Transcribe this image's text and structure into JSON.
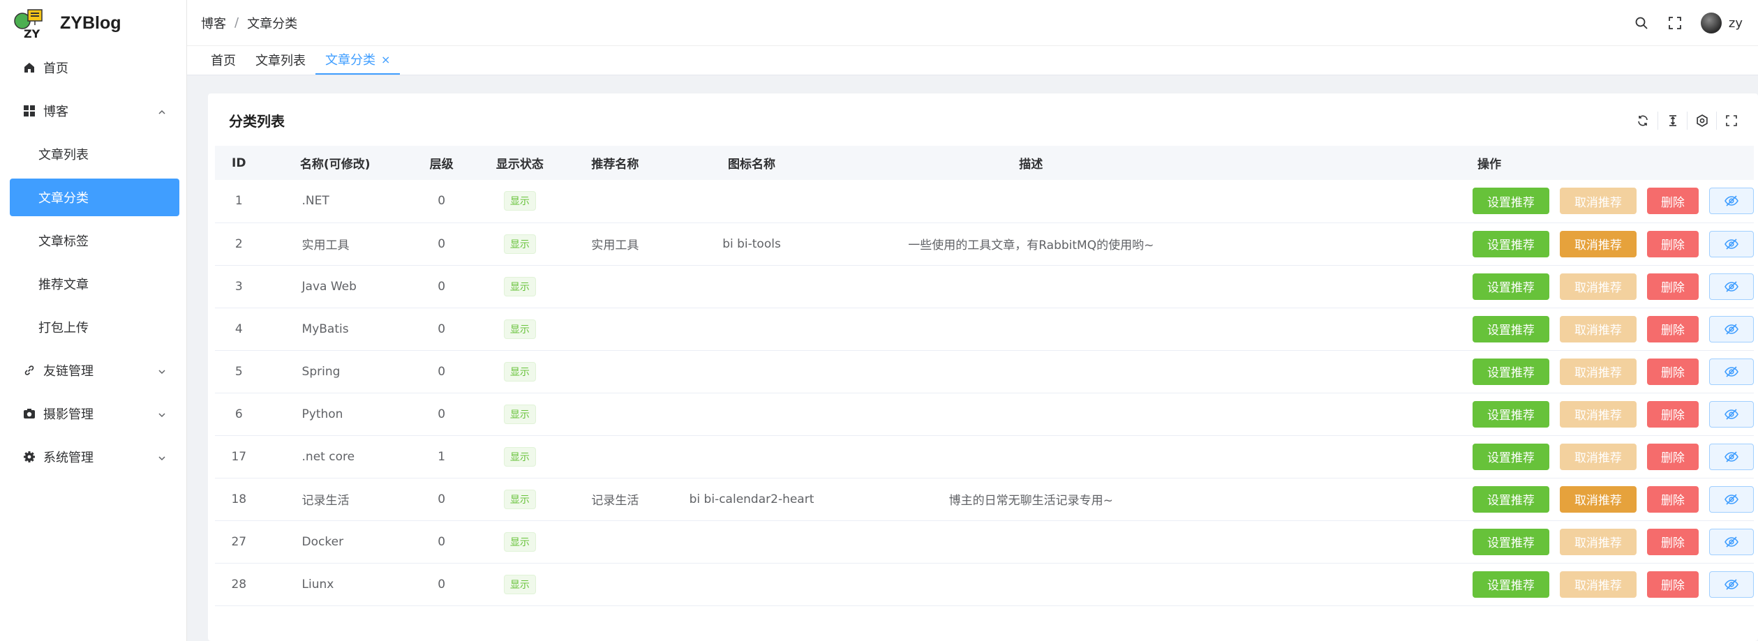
{
  "app": {
    "title": "ZYBlog",
    "logo_text": "ZY"
  },
  "sidebar": {
    "items": [
      {
        "label": "首页"
      },
      {
        "label": "博客",
        "children": [
          {
            "label": "文章列表"
          },
          {
            "label": "文章分类"
          },
          {
            "label": "文章标签"
          },
          {
            "label": "推荐文章"
          },
          {
            "label": "打包上传"
          }
        ]
      },
      {
        "label": "友链管理"
      },
      {
        "label": "摄影管理"
      },
      {
        "label": "系统管理"
      }
    ]
  },
  "header": {
    "breadcrumb": [
      "博客",
      "文章分类"
    ],
    "breadcrumb_sep": "/",
    "user_name": "zy"
  },
  "tabs": [
    {
      "label": "首页"
    },
    {
      "label": "文章列表"
    },
    {
      "label": "文章分类",
      "close": "×"
    }
  ],
  "card": {
    "title": "分类列表"
  },
  "table": {
    "headers": [
      "ID",
      "名称(可修改)",
      "层级",
      "显示状态",
      "推荐名称",
      "图标名称",
      "描述",
      "操作"
    ],
    "buttons": {
      "recommend": "设置推荐",
      "unrecommend": "取消推荐",
      "delete": "删除"
    },
    "rows": [
      {
        "id": "1",
        "name": ".NET",
        "level": "0",
        "status": "显示",
        "rec_name": "",
        "icon": "",
        "desc": "",
        "recommended": false
      },
      {
        "id": "2",
        "name": "实用工具",
        "level": "0",
        "status": "显示",
        "rec_name": "实用工具",
        "icon": "bi bi-tools",
        "desc": "一些使用的工具文章，有RabbitMQ的使用哟~",
        "recommended": true
      },
      {
        "id": "3",
        "name": "Java Web",
        "level": "0",
        "status": "显示",
        "rec_name": "",
        "icon": "",
        "desc": "",
        "recommended": false
      },
      {
        "id": "4",
        "name": "MyBatis",
        "level": "0",
        "status": "显示",
        "rec_name": "",
        "icon": "",
        "desc": "",
        "recommended": false
      },
      {
        "id": "5",
        "name": "Spring",
        "level": "0",
        "status": "显示",
        "rec_name": "",
        "icon": "",
        "desc": "",
        "recommended": false
      },
      {
        "id": "6",
        "name": "Python",
        "level": "0",
        "status": "显示",
        "rec_name": "",
        "icon": "",
        "desc": "",
        "recommended": false
      },
      {
        "id": "17",
        "name": ".net core",
        "level": "1",
        "status": "显示",
        "rec_name": "",
        "icon": "",
        "desc": "",
        "recommended": false
      },
      {
        "id": "18",
        "name": "记录生活",
        "level": "0",
        "status": "显示",
        "rec_name": "记录生活",
        "icon": "bi bi-calendar2-heart",
        "desc": "博主的日常无聊生活记录专用~",
        "recommended": true
      },
      {
        "id": "27",
        "name": "Docker",
        "level": "0",
        "status": "显示",
        "rec_name": "",
        "icon": "",
        "desc": "",
        "recommended": false
      },
      {
        "id": "28",
        "name": "Liunx",
        "level": "0",
        "status": "显示",
        "rec_name": "",
        "icon": "",
        "desc": "",
        "recommended": false
      }
    ]
  },
  "colors": {
    "primary": "#409eff",
    "success": "#67c23a",
    "warning": "#e6a23c",
    "danger": "#f56c6c"
  }
}
